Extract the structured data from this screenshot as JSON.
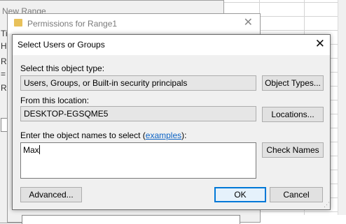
{
  "background_window": {
    "title": "New Range",
    "letters": [
      "Ti",
      "H",
      "R",
      "=",
      "Ra"
    ]
  },
  "permissions_window": {
    "title": "Permissions for Range1",
    "close_glyph": "✕"
  },
  "dialog": {
    "title": "Select Users or Groups",
    "close_glyph": "✕",
    "object_type_label": "Select this object type:",
    "object_type_value": "Users, Groups, or Built-in security principals",
    "object_types_button": "Object Types...",
    "location_label": "From this location:",
    "location_value": "DESKTOP-EGSQME5",
    "locations_button": "Locations...",
    "names_label_prefix": "Enter the object names to select (",
    "names_label_link": "examples",
    "names_label_suffix": "):",
    "names_value": "Max",
    "check_names_button": "Check Names",
    "advanced_button": "Advanced...",
    "ok_button": "OK",
    "cancel_button": "Cancel"
  },
  "colors": {
    "accent": "#0078d7",
    "link": "#0b62c4"
  }
}
